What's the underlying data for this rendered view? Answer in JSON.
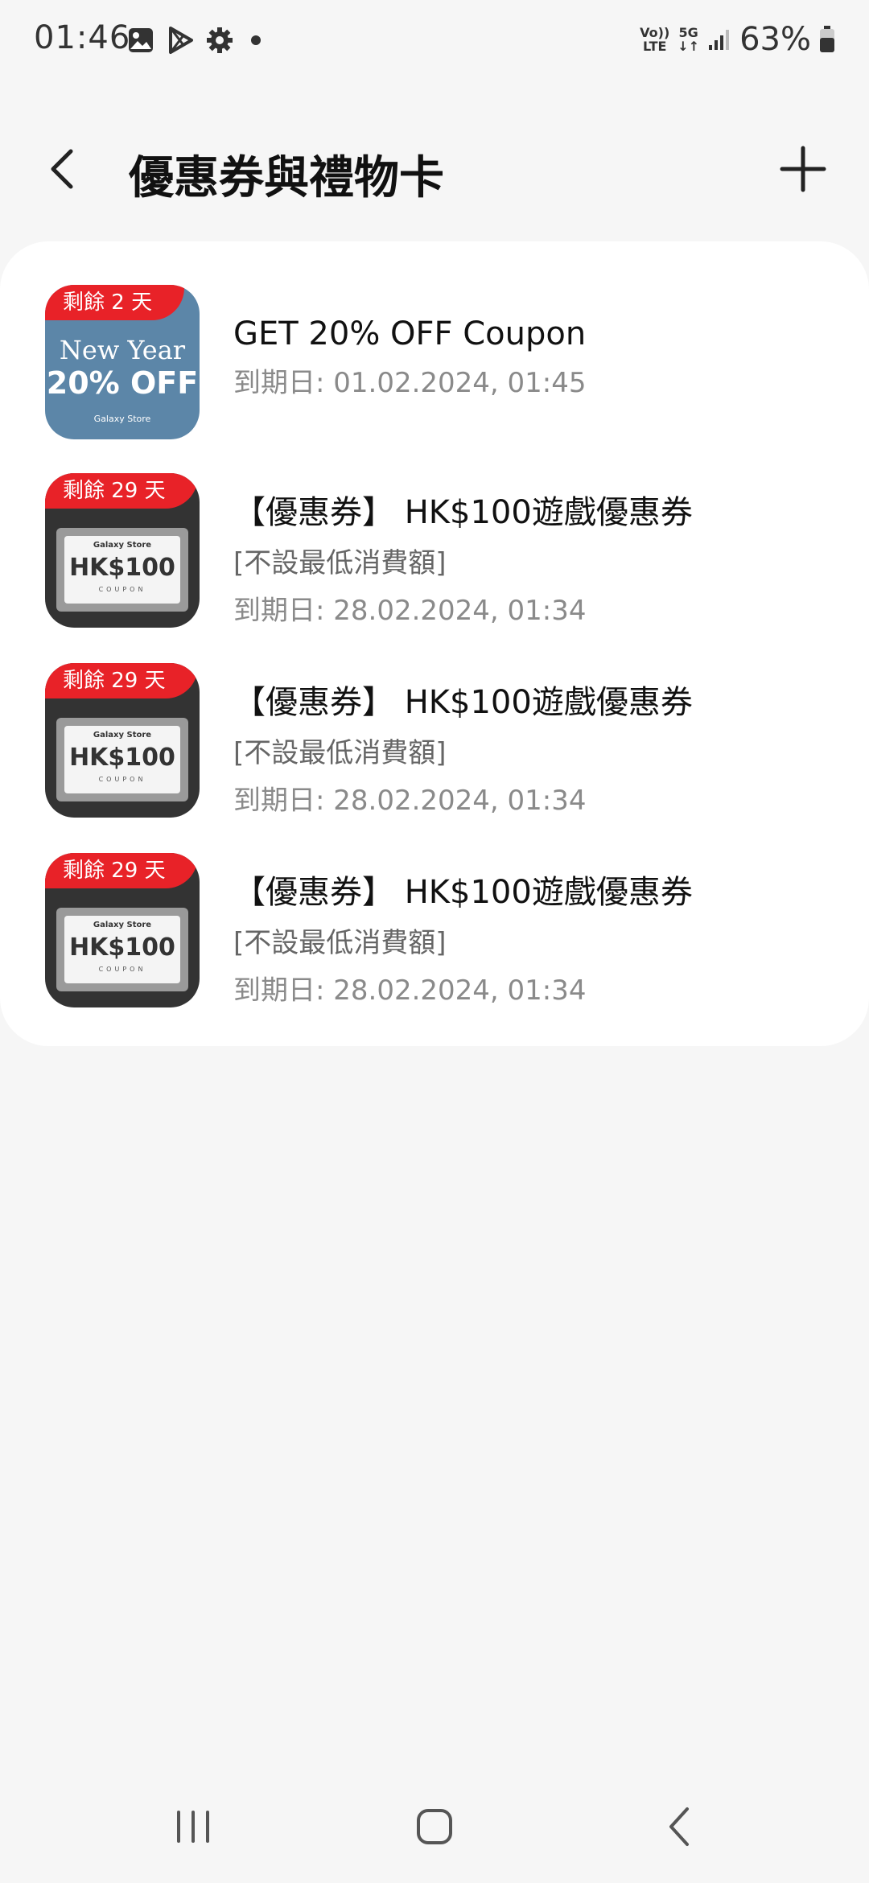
{
  "status_bar": {
    "time": "01:46",
    "network_volte_line1": "Vo))",
    "network_volte_line2": "LTE",
    "network_5g_line1": "5G",
    "network_5g_line2": "↓↑",
    "battery": "63%"
  },
  "header": {
    "title": "優惠券與禮物卡",
    "back_icon": "chevron-left-icon",
    "add_icon": "plus-icon"
  },
  "coupons": [
    {
      "badge": "剩餘 2 天",
      "thumb_line1": "New Year",
      "thumb_line2": "20% OFF",
      "thumb_store": "Galaxy Store",
      "name": "GET 20% OFF Coupon",
      "expiry": "到期日: 01.02.2024, 01:45"
    },
    {
      "badge": "剩餘 29 天",
      "thumb_store": "Galaxy Store",
      "thumb_amount": "HK$100",
      "thumb_coupon": "COUPON",
      "name": "【優惠券】 HK$100遊戲優惠券",
      "condition": "[不設最低消費額]",
      "expiry": "到期日: 28.02.2024, 01:34"
    },
    {
      "badge": "剩餘 29 天",
      "thumb_store": "Galaxy Store",
      "thumb_amount": "HK$100",
      "thumb_coupon": "COUPON",
      "name": "【優惠券】 HK$100遊戲優惠券",
      "condition": "[不設最低消費額]",
      "expiry": "到期日: 28.02.2024, 01:34"
    },
    {
      "badge": "剩餘 29 天",
      "thumb_store": "Galaxy Store",
      "thumb_amount": "HK$100",
      "thumb_coupon": "COUPON",
      "name": "【優惠券】 HK$100遊戲優惠券",
      "condition": "[不設最低消費額]",
      "expiry": "到期日: 28.02.2024, 01:34"
    }
  ],
  "colors": {
    "badge_red": "#e82228",
    "background": "#f6f6f6",
    "card": "#ffffff"
  }
}
